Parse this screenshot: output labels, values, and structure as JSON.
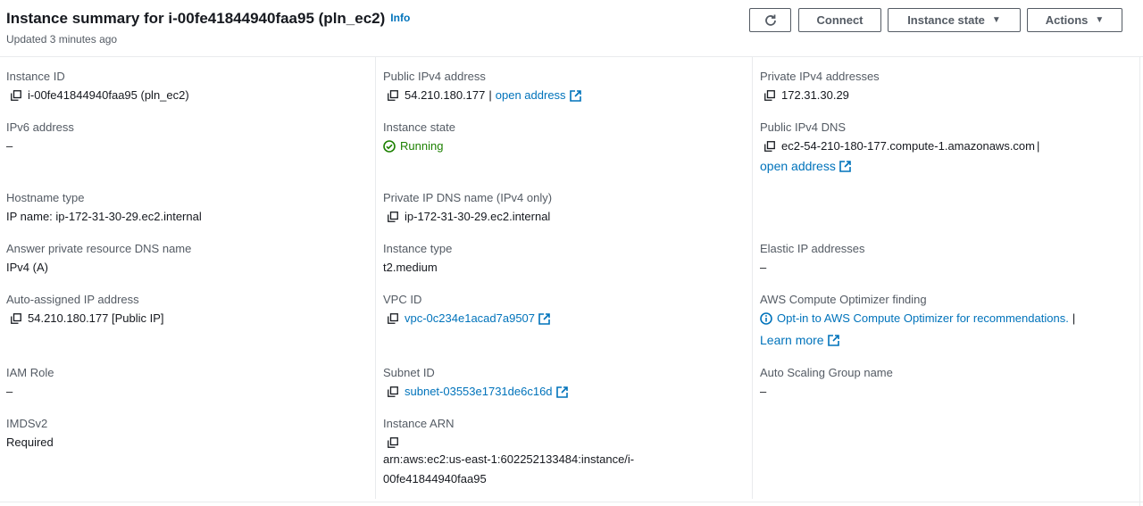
{
  "header": {
    "title": "Instance summary for i-00fe41844940faa95 (pln_ec2)",
    "info": "Info",
    "updated": "Updated 3 minutes ago",
    "buttons": {
      "connect": "Connect",
      "instance_state": "Instance state",
      "actions": "Actions"
    }
  },
  "col1": {
    "instance_id": {
      "label": "Instance ID",
      "value": "i-00fe41844940faa95 (pln_ec2)"
    },
    "ipv6": {
      "label": "IPv6 address",
      "value": "–"
    },
    "hostname_type": {
      "label": "Hostname type",
      "value": "IP name: ip-172-31-30-29.ec2.internal"
    },
    "answer_dns": {
      "label": "Answer private resource DNS name",
      "value": "IPv4 (A)"
    },
    "auto_ip": {
      "label": "Auto-assigned IP address",
      "value": "54.210.180.177 [Public IP]"
    },
    "iam_role": {
      "label": "IAM Role",
      "value": "–"
    },
    "imdsv2": {
      "label": "IMDSv2",
      "value": "Required"
    }
  },
  "col2": {
    "public_ipv4": {
      "label": "Public IPv4 address",
      "value": "54.210.180.177",
      "sep": "|",
      "link": "open address"
    },
    "instance_state": {
      "label": "Instance state",
      "value": "Running"
    },
    "private_dns": {
      "label": "Private IP DNS name (IPv4 only)",
      "value": "ip-172-31-30-29.ec2.internal"
    },
    "instance_type": {
      "label": "Instance type",
      "value": "t2.medium"
    },
    "vpc_id": {
      "label": "VPC ID",
      "value": "vpc-0c234e1acad7a9507"
    },
    "subnet_id": {
      "label": "Subnet ID",
      "value": "subnet-03553e1731de6c16d"
    },
    "arn": {
      "label": "Instance ARN",
      "value_line1": "arn:aws:ec2:us-east-1:602252133484:instance/i-",
      "value_line2": "00fe41844940faa95"
    }
  },
  "col3": {
    "private_ipv4": {
      "label": "Private IPv4 addresses",
      "value": "172.31.30.29"
    },
    "public_dns": {
      "label": "Public IPv4 DNS",
      "value": "ec2-54-210-180-177.compute-1.amazonaws.com",
      "sep": "|",
      "link": "open address"
    },
    "elastic_ip": {
      "label": "Elastic IP addresses",
      "value": "–"
    },
    "optimizer": {
      "label": "AWS Compute Optimizer finding",
      "link": "Opt-in to AWS Compute Optimizer for recommendations.",
      "sep": "|",
      "learn_more": "Learn more"
    },
    "asg": {
      "label": "Auto Scaling Group name",
      "value": "–"
    }
  },
  "colors": {
    "link": "#0073bb",
    "running": "#1d8102",
    "label": "#545b64",
    "border": "#e9ebed"
  }
}
